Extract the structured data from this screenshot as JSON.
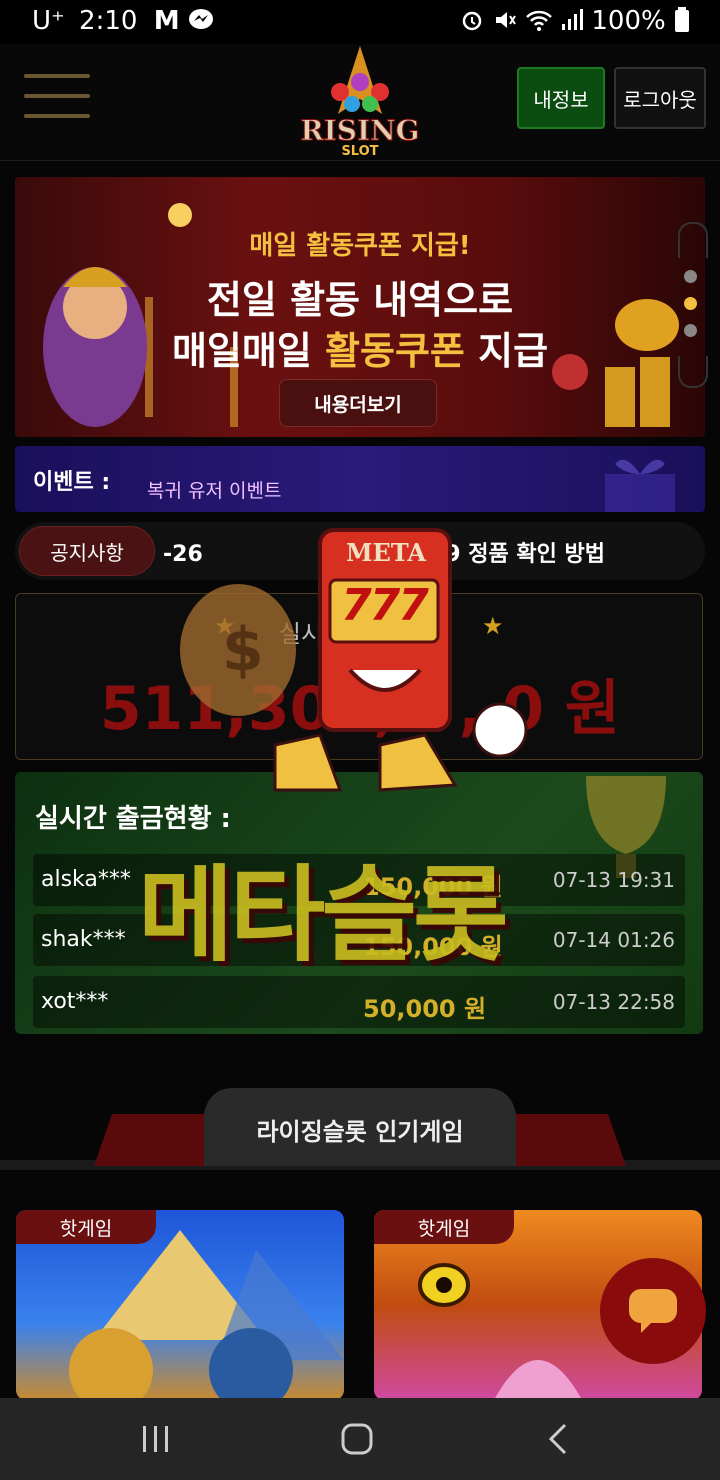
{
  "status_bar": {
    "carrier": "U⁺",
    "time": "2:10",
    "battery": "100%",
    "left_icons": [
      "gmail-icon",
      "messenger-icon"
    ],
    "right_icons": [
      "alarm-icon",
      "mute-icon",
      "wifi-icon",
      "signal-icon",
      "battery-icon"
    ]
  },
  "header": {
    "menu_icon": "hamburger-icon",
    "logo_text_main": "RISING",
    "logo_text_sub": "SLOT",
    "mypage_label": "내정보",
    "logout_label": "로그아웃"
  },
  "banner": {
    "subtitle": "매일 활동쿠폰 지급!",
    "line1": "전일 활동 내역으로",
    "line2_a": "매일매일 ",
    "line2_highlight": "활동쿠폰",
    "line2_b": " 지급",
    "button": "내용더보기",
    "slides": 3,
    "active_slide": 2
  },
  "event": {
    "label": "이벤트 :",
    "value": "복귀 유저 이벤트"
  },
  "notice": {
    "label": "공지사항",
    "message_left": "-26",
    "message_right": "CQ9 정품 확인 방법"
  },
  "jackpot": {
    "title": "실시간 잭팟금액",
    "amount": "511,305,3  ,  0 원"
  },
  "watermark": {
    "text": "메타슬롯",
    "mascot_label": "META",
    "mascot_digits": "777"
  },
  "withdraw": {
    "title": "실시간 출금현황 :",
    "rows": [
      {
        "user": "alska***",
        "amount": "150,000 원",
        "date": "07-13 19:31"
      },
      {
        "user": "shak***",
        "amount": "150,000 원",
        "date": "07-14 01:26"
      },
      {
        "user": "xot***",
        "amount": "50,000 원",
        "date": "07-13 22:58"
      }
    ]
  },
  "popular": {
    "title": "라이징슬롯 인기게임",
    "games": [
      {
        "badge": "핫게임"
      },
      {
        "badge": "핫게임"
      }
    ]
  },
  "chat_button_icon": "chat-bubble-icon",
  "navbar": {
    "icons": [
      "recent-apps-icon",
      "home-icon",
      "back-icon"
    ]
  },
  "colors": {
    "gold": "#f4c040",
    "accent_red": "#8a0b0b",
    "mypage_green": "#0b4d10",
    "event_blue": "#1a0f5a",
    "withdraw_green": "#1c4a1c"
  }
}
